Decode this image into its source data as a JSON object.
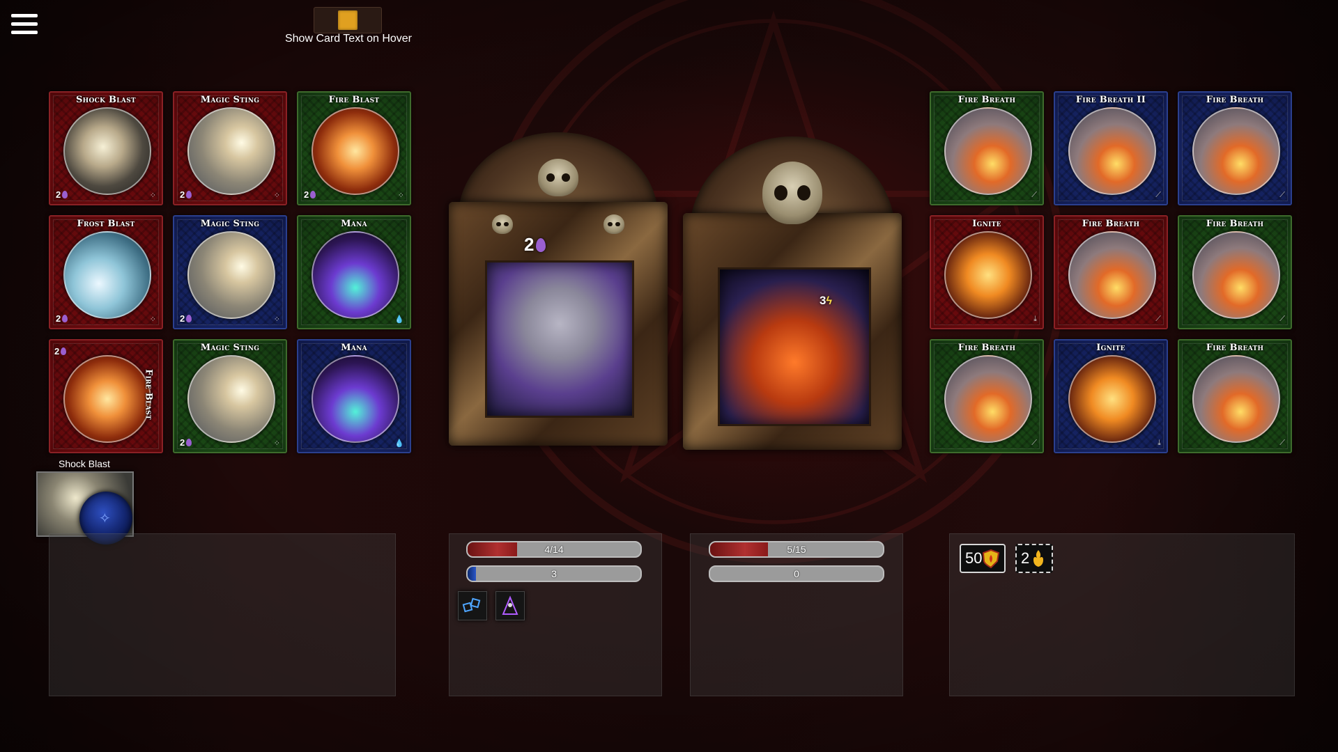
{
  "settings": {
    "hover_label": "Show Card Text on Hover"
  },
  "colors": {
    "toggle": "#e0a020",
    "mana": "#9a5fd0",
    "health": "#b03030",
    "shield": "#2a56c8"
  },
  "player_cards": [
    {
      "title": "Shock Blast",
      "cost": "2",
      "color": "red",
      "art": "lightning-icon"
    },
    {
      "title": "Magic Sting",
      "cost": "2",
      "color": "red",
      "art": "wizard-icon"
    },
    {
      "title": "Fire Blast",
      "cost": "2",
      "color": "green",
      "art": "fire-icon"
    },
    {
      "title": "Frost Blast",
      "cost": "2",
      "color": "red",
      "art": "frost-icon"
    },
    {
      "title": "Magic Sting",
      "cost": "2",
      "color": "blue",
      "art": "wizard-icon"
    },
    {
      "title": "Mana",
      "cost": "",
      "color": "green",
      "art": "potion-icon"
    },
    {
      "title": "Fire Blast",
      "cost": "2",
      "color": "red",
      "art": "fire-icon"
    },
    {
      "title": "Magic Sting",
      "cost": "2",
      "color": "green",
      "art": "wizard-icon"
    },
    {
      "title": "Mana",
      "cost": "",
      "color": "blue",
      "art": "potion-icon"
    }
  ],
  "enemy_cards": [
    {
      "title": "Fire Breath",
      "color": "green"
    },
    {
      "title": "Fire Breath II",
      "color": "blue"
    },
    {
      "title": "Fire Breath",
      "color": "blue"
    },
    {
      "title": "Ignite",
      "color": "red"
    },
    {
      "title": "Fire Breath",
      "color": "red"
    },
    {
      "title": "Fire Breath",
      "color": "green"
    },
    {
      "title": "Fire Breath",
      "color": "green"
    },
    {
      "title": "Ignite",
      "color": "blue"
    },
    {
      "title": "Fire Breath",
      "color": "green"
    }
  ],
  "player": {
    "mana_badge": "2",
    "health_text": "4/14",
    "health_fraction": 0.2857,
    "shield_text": "3",
    "shield_fraction": 0.05
  },
  "enemy": {
    "intent_badge": "3",
    "health_text": "5/15",
    "health_fraction": 0.3333,
    "shield_text": "0",
    "shield_fraction": 0
  },
  "hand": {
    "label": "Shock Blast"
  },
  "enemy_stats": [
    {
      "value": "50",
      "icon": "shield-fire-icon"
    },
    {
      "value": "2",
      "icon": "flame-hands-icon"
    }
  ],
  "player_effects": [
    "ice-cubes-icon",
    "hooded-figure-icon"
  ]
}
